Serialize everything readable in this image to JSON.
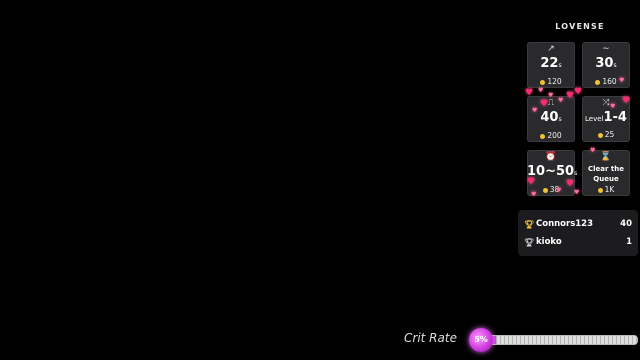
{
  "brand": {
    "logo_text": "LOVENSE"
  },
  "tiles": [
    {
      "icon": "pulse-icon",
      "glyph": "↗",
      "value": "22",
      "unit": "s",
      "cost": "120"
    },
    {
      "icon": "wave-icon",
      "glyph": "∼",
      "value": "30",
      "unit": "s",
      "cost": "160"
    },
    {
      "icon": "square-wave-icon",
      "glyph": "⎍",
      "value": "40",
      "unit": "s",
      "cost": "200"
    },
    {
      "icon": "shuffle-icon",
      "glyph": "⤨",
      "prefix": "Level",
      "value": "1-4",
      "cost": "25"
    },
    {
      "icon": "alarm-clock-icon",
      "glyph": "⏰",
      "value": "10~50",
      "unit": "s",
      "cost": "38"
    },
    {
      "icon": "hourglass-icon",
      "glyph": "⌛",
      "text_line1": "Clear the",
      "text_line2": "Queue",
      "cost": "1K"
    }
  ],
  "leaderboard": [
    {
      "icon": "trophy-icon",
      "name": "Connors123",
      "value": "40"
    },
    {
      "icon": "trophy-icon",
      "name": "kioko",
      "value": "1"
    }
  ],
  "crit": {
    "label": "Crit Rate",
    "percent_text": "5%",
    "fraction": 0.05
  },
  "colors": {
    "accent": "#d040e0",
    "heart": "#ff2a6e",
    "coin": "#f2c335"
  }
}
